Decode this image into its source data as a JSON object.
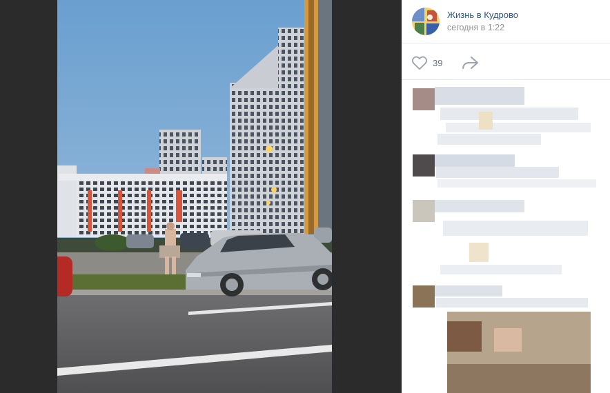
{
  "post": {
    "group_name": "Жизнь в Кудрово",
    "time": "сегодня в 1:22"
  },
  "actions": {
    "likes_count": "39",
    "like_icon": "heart-outline-icon",
    "share_icon": "share-arrow-icon"
  },
  "colors": {
    "link": "#2a5885",
    "muted": "#939393",
    "viewer_bg": "#2b2b2b"
  }
}
